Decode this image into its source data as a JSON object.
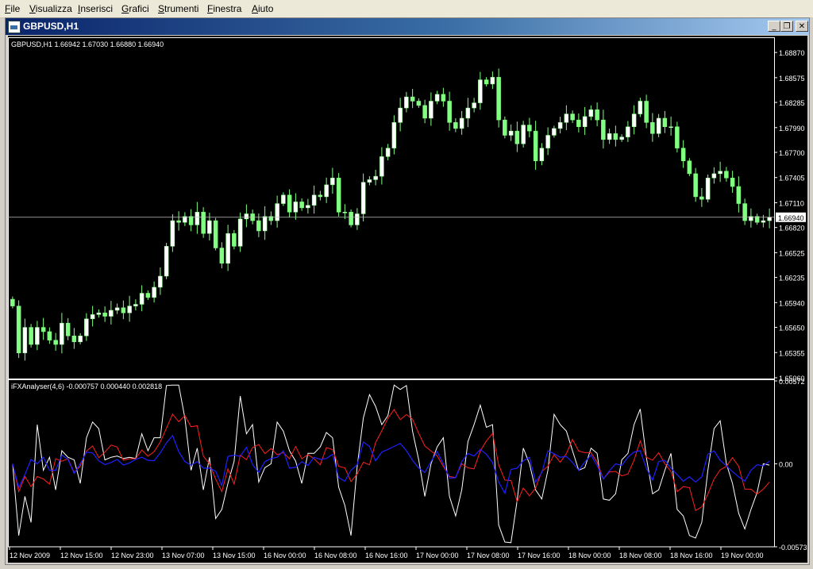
{
  "menu": [
    {
      "label": "File",
      "accel": "F",
      "rest": "ile"
    },
    {
      "label": "Visualizza",
      "accel": "V",
      "rest": "isualizza"
    },
    {
      "label": "Inserisci",
      "accel": "I",
      "rest": "nserisci"
    },
    {
      "label": "Grafici",
      "accel": "G",
      "rest": "rafici"
    },
    {
      "label": "Strumenti",
      "accel": "S",
      "rest": "trumenti"
    },
    {
      "label": "Finestra",
      "accel": "F",
      "rest": "inestra"
    },
    {
      "label": "Aiuto",
      "accel": "A",
      "rest": "iuto"
    }
  ],
  "window": {
    "title": "GBPUSD,H1",
    "icon": "chart-window-icon",
    "buttons": {
      "minimize": "_",
      "restore": "❐",
      "close": "✕"
    }
  },
  "colors": {
    "background": "#000000",
    "bull": "#ffffff",
    "bear": "#80ff80",
    "wick": "#80ff80",
    "grid": "#ffffff",
    "price_line": "#c0c0c0",
    "osc_white": "#ffffff",
    "osc_red": "#ff2020",
    "osc_blue": "#2020ff"
  },
  "chart_data": [
    {
      "type": "candlestick",
      "title": "GBPUSD,H1  1.66942 1.67030 1.66880 1.66940",
      "ylim": [
        1.6506,
        1.6902
      ],
      "y_ticks": [
        "1.68870",
        "1.68575",
        "1.68285",
        "1.67990",
        "1.67700",
        "1.67405",
        "1.67110",
        "1.66820",
        "1.66525",
        "1.66235",
        "1.65940",
        "1.65650",
        "1.65355",
        "1.65060"
      ],
      "current_price": "1.66940",
      "x_ticks": [
        "12 Nov 2009",
        "12 Nov 15:00",
        "12 Nov 23:00",
        "13 Nov 07:00",
        "13 Nov 15:00",
        "16 Nov 00:00",
        "16 Nov 08:00",
        "16 Nov 16:00",
        "17 Nov 00:00",
        "17 Nov 08:00",
        "17 Nov 16:00",
        "18 Nov 00:00",
        "18 Nov 08:00",
        "18 Nov 16:00",
        "19 Nov 00:00"
      ],
      "closes": [
        1.659,
        1.6535,
        1.6565,
        1.6545,
        1.6565,
        1.656,
        1.655,
        1.6545,
        1.657,
        1.6555,
        1.6548,
        1.6555,
        1.6575,
        1.658,
        1.6582,
        1.6578,
        1.6585,
        1.6588,
        1.6582,
        1.659,
        1.6592,
        1.6605,
        1.66,
        1.6612,
        1.6625,
        1.666,
        1.669,
        1.6688,
        1.6695,
        1.6685,
        1.67,
        1.6675,
        1.669,
        1.6658,
        1.664,
        1.6675,
        1.666,
        1.6692,
        1.6698,
        1.669,
        1.6678,
        1.6695,
        1.669,
        1.671,
        1.672,
        1.67,
        1.6712,
        1.6705,
        1.6708,
        1.672,
        1.6718,
        1.6732,
        1.674,
        1.67,
        1.67,
        1.6685,
        1.6698,
        1.6735,
        1.6738,
        1.6742,
        1.6765,
        1.6775,
        1.6805,
        1.6822,
        1.6835,
        1.683,
        1.6825,
        1.681,
        1.683,
        1.6838,
        1.683,
        1.6805,
        1.6798,
        1.681,
        1.6822,
        1.6828,
        1.6855,
        1.685,
        1.6858,
        1.6808,
        1.679,
        1.6795,
        1.678,
        1.6802,
        1.6795,
        1.676,
        1.6775,
        1.679,
        1.6798,
        1.6805,
        1.6815,
        1.6808,
        1.68,
        1.6812,
        1.682,
        1.6808,
        1.6785,
        1.6792,
        1.6785,
        1.6788,
        1.68,
        1.6815,
        1.683,
        1.6805,
        1.6792,
        1.681,
        1.68,
        1.68,
        1.6775,
        1.676,
        1.6745,
        1.6718,
        1.6715,
        1.674,
        1.6745,
        1.6748,
        1.674,
        1.673,
        1.671,
        1.669,
        1.6695,
        1.6688,
        1.669,
        1.6694
      ],
      "oscillator": {
        "label": "iFXAnalyser(4,6) -0.000757 0.000440 0.002818",
        "ylim": [
          -0.00573,
          0.00572
        ],
        "y_ticks": [
          "0.00572",
          "0.00",
          "-0.00573"
        ]
      }
    }
  ]
}
